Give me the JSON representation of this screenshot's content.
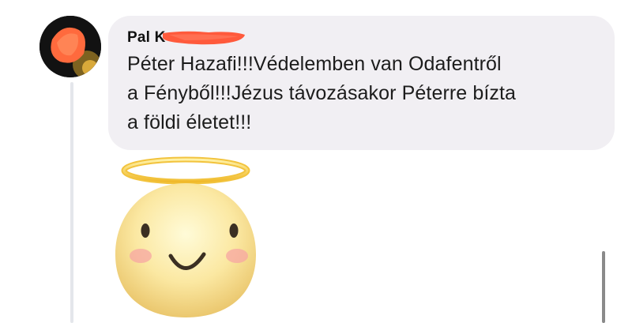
{
  "comment": {
    "author_visible": "Pal K",
    "message_lines": [
      "Péter Hazafi!!!Védelemben van Odafentről",
      "a Fényből!!!Jézus távozásakor Péterre bízta",
      "a földi életet!!!"
    ],
    "reaction_emoji": "angel-face-emoji"
  },
  "colors": {
    "bubble_background": "#f1eff3",
    "text": "#1c1c1c",
    "redaction": "#ff5a3c",
    "thread_line": "#e4e6eb",
    "halo": "#f4c430"
  },
  "icons": {
    "avatar": "profile-avatar",
    "emoji": "angel-smiley-icon"
  }
}
